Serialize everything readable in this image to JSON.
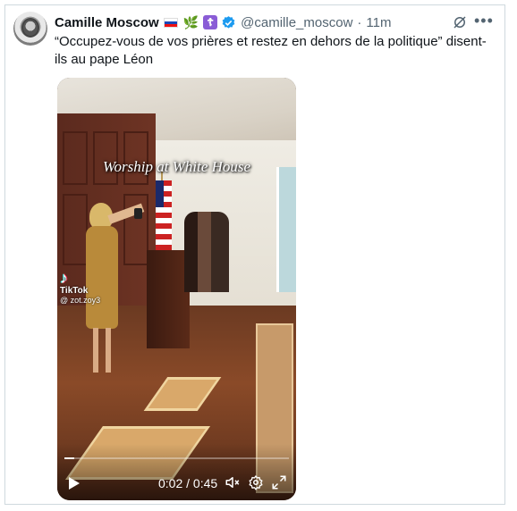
{
  "post": {
    "author_name": "Camille Moscow",
    "handle": "@camille_moscow",
    "separator": "·",
    "time_ago": "11m",
    "text": "“Occupez-vous de vos prières et restez en dehors de la politique” disent-ils au pape Léon"
  },
  "icons": {
    "flag": "russia-flag-icon",
    "leaf": "leaf-emoji-icon",
    "cross": "orthodox-cross-icon",
    "verified": "verified-badge-icon",
    "grok": "grok-icon",
    "more": "more-options-icon"
  },
  "video": {
    "overlay_caption": "Worship at White House",
    "watermark_brand": "TikTok",
    "watermark_user": "@ zot.zoy3",
    "current_time": "0:02",
    "time_separator": "/",
    "duration": "0:45",
    "progress_fraction": 0.044
  },
  "colors": {
    "verified": "#1d9bf0",
    "secondary_text": "#536471",
    "border": "#cfd9de"
  }
}
